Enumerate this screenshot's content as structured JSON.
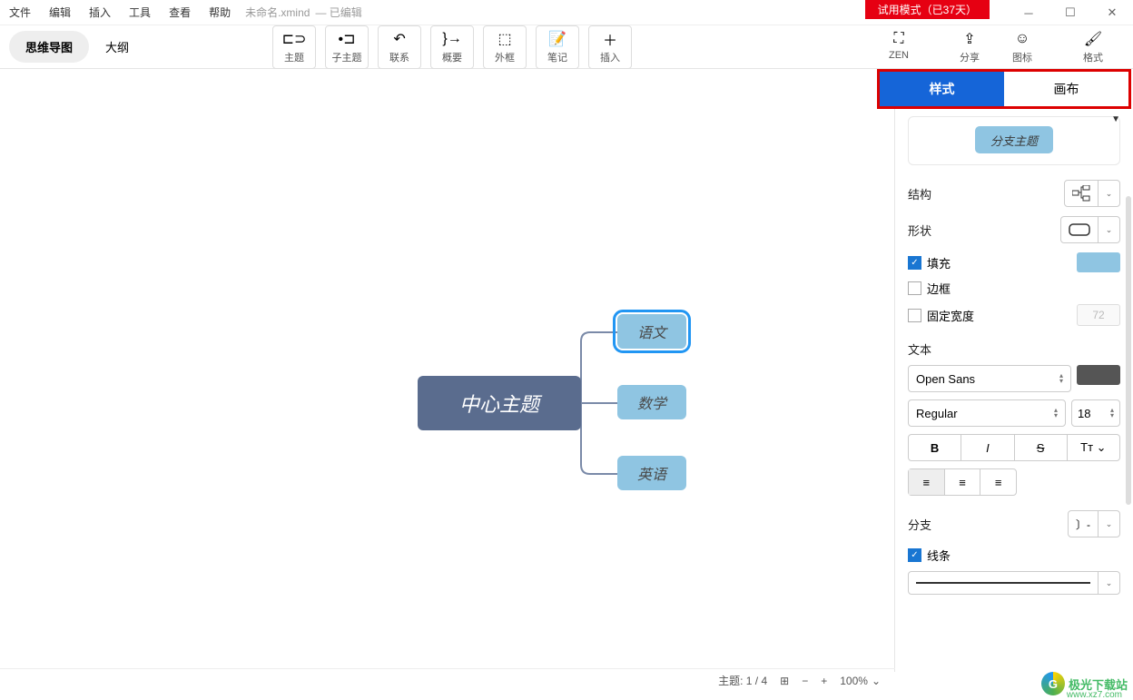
{
  "menu": {
    "file": "文件",
    "edit": "编辑",
    "insert": "插入",
    "tools": "工具",
    "view": "查看",
    "help": "帮助"
  },
  "doc": {
    "name": "未命名.xmind",
    "status": "— 已编辑"
  },
  "trial": "试用模式（已37天）",
  "viewTabs": {
    "mindmap": "思维导图",
    "outline": "大纲"
  },
  "tools": {
    "topic": "主题",
    "subtopic": "子主题",
    "relation": "联系",
    "summary": "概要",
    "boundary": "外框",
    "note": "笔记",
    "insert": "插入",
    "zen": "ZEN",
    "share": "分享",
    "icons": "图标",
    "format": "格式"
  },
  "nodes": {
    "central": "中心主题",
    "c1": "语文",
    "c2": "数学",
    "c3": "英语"
  },
  "panel": {
    "tabStyle": "样式",
    "tabCanvas": "画布",
    "sampleLabel": "分支主题",
    "structure": "结构",
    "shape": "形状",
    "fill": "填充",
    "border": "边框",
    "fixedWidth": "固定宽度",
    "widthValue": "72",
    "text": "文本",
    "font": "Open Sans",
    "weight": "Regular",
    "size": "18",
    "branch": "分支",
    "line": "线条"
  },
  "status": {
    "topicCount": "主题: 1 / 4",
    "zoom": "100%"
  },
  "watermark": {
    "text": "极光下载站",
    "url": "www.xz7.com"
  }
}
